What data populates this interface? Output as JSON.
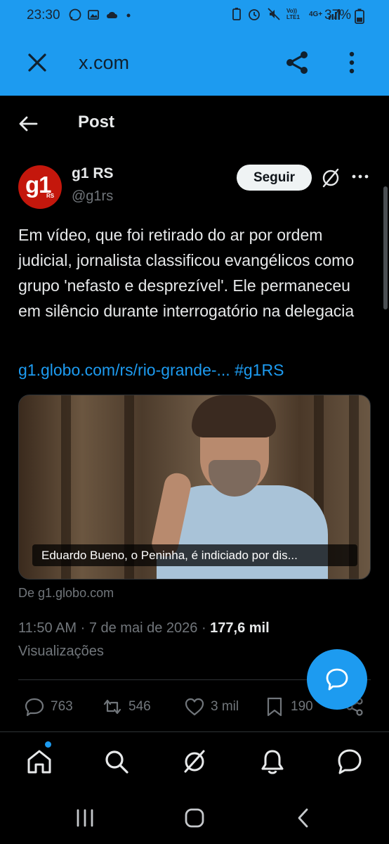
{
  "status_bar": {
    "time": "23:30",
    "battery": "37%",
    "network": "4G+",
    "volte": "Vo)) LTE1"
  },
  "browser": {
    "url": "x.com"
  },
  "header": {
    "title": "Post"
  },
  "author": {
    "name": "g1 RS",
    "handle": "@g1rs",
    "avatar_text": "g1",
    "avatar_sub": "RS",
    "follow_label": "Seguir"
  },
  "post": {
    "text": "Em vídeo, que foi retirado do ar por ordem judicial, jornalista classificou evangélicos como grupo 'nefasto e desprezível'. Ele permaneceu em silêncio durante interrogatório na delegacia",
    "link": "g1.globo.com/rs/rio-grande-...",
    "hashtag": "#g1RS",
    "media_caption": "Eduardo Bueno, o Peninha, é indiciado por dis...",
    "media_source": "De g1.globo.com",
    "time": "11:50 AM",
    "date": "7 de mai de 2026",
    "views": "177,6 mil",
    "views_label": "Visualizações"
  },
  "actions": {
    "replies": "763",
    "reposts": "546",
    "likes": "3 mil",
    "bookmarks": "190"
  },
  "colors": {
    "accent": "#1d9bf0",
    "background": "#000000",
    "text": "#e7e9ea",
    "muted": "#71767b",
    "brand_g1": "#c4170c"
  }
}
